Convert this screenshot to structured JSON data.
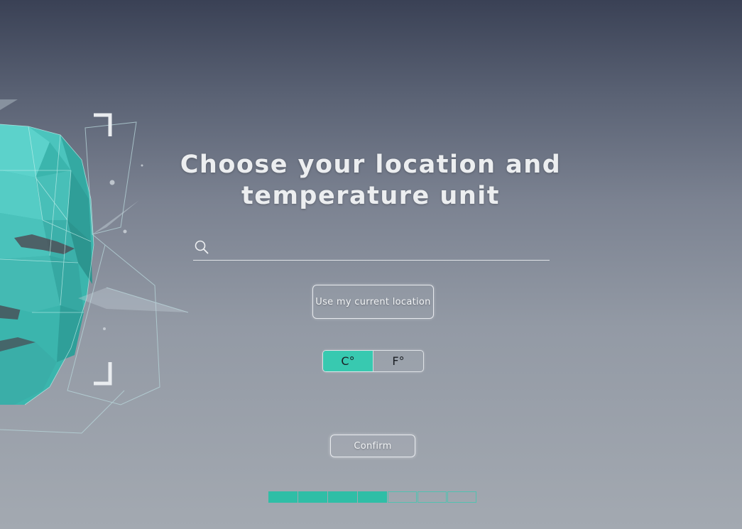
{
  "screen": {
    "title_line1": "Choose your location and",
    "title_line2": "temperature unit"
  },
  "search": {
    "value": "",
    "placeholder": "",
    "icon": "search-icon"
  },
  "location_button": {
    "label": "Use my current location"
  },
  "unit_toggle": {
    "options": [
      {
        "label": "C°",
        "selected": true
      },
      {
        "label": "F°",
        "selected": false
      }
    ]
  },
  "confirm_button": {
    "label": "Confirm"
  },
  "progress": {
    "total_steps": 7,
    "completed_steps": 4
  },
  "colors": {
    "accent": "#38c9b0",
    "background_top": "#3a4155",
    "background_bottom": "#a3a9b1",
    "text": "#eceef0"
  },
  "decoration": {
    "icon": "polygon-face-illustration"
  }
}
